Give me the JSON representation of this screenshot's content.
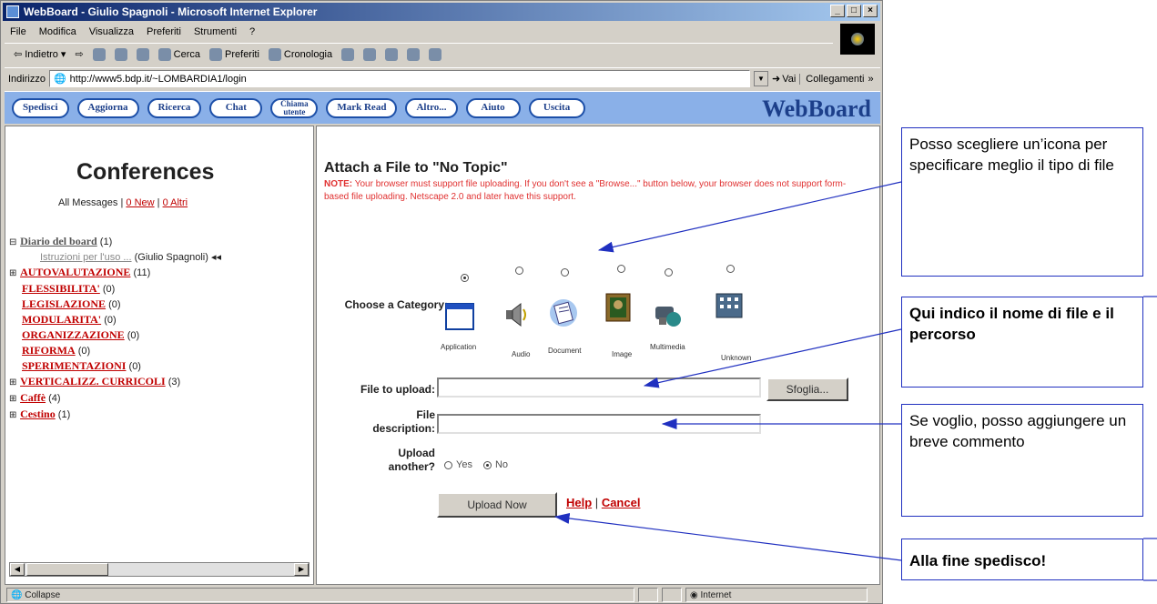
{
  "window": {
    "title": "WebBoard - Giulio Spagnoli - Microsoft Internet Explorer",
    "controls": [
      "_",
      "□",
      "×"
    ]
  },
  "menu": [
    "File",
    "Modifica",
    "Visualizza",
    "Preferiti",
    "Strumenti",
    "?"
  ],
  "toolbar": [
    "Indietro",
    "Cerca",
    "Preferiti",
    "Cronologia"
  ],
  "address": {
    "label": "Indirizzo",
    "url": "http://www5.bdp.it/~LOMBARDIA1/login",
    "go": "Vai",
    "links": "Collegamenti"
  },
  "webboard_nav": {
    "buttons": [
      "Spedisci",
      "Aggiorna",
      "Ricerca",
      "Chat",
      "Chiama utente",
      "Mark Read",
      "Altro...",
      "Aiuto",
      "Uscita"
    ],
    "logo": "WebBoard"
  },
  "conferences": {
    "title": "Conferences",
    "all_messages": "All Messages |",
    "new_link": "0 New",
    "altri_link": "0 Altri",
    "items": [
      {
        "name": "Diario del board",
        "count": "(1)",
        "marker": "⊟"
      },
      {
        "name": "Istruzioni per l'uso ...",
        "count": "(Giulio Spagnoli) ◂◂"
      },
      {
        "name": "AUTOVALUTAZIONE",
        "count": "(11)",
        "marker": "⊞"
      },
      {
        "name": "FLESSIBILITA'",
        "count": "(0)"
      },
      {
        "name": "LEGISLAZIONE",
        "count": "(0)"
      },
      {
        "name": "MODULARITA'",
        "count": "(0)"
      },
      {
        "name": "ORGANIZZAZIONE",
        "count": "(0)"
      },
      {
        "name": "RIFORMA",
        "count": "(0)"
      },
      {
        "name": "SPERIMENTAZIONI",
        "count": "(0)"
      },
      {
        "name": "VERTICALIZZ. CURRICOLI",
        "count": "(3)",
        "marker": "⊞"
      },
      {
        "name": "Caffè",
        "count": "(4)",
        "marker": "⊞"
      },
      {
        "name": "Cestino",
        "count": "(1)",
        "marker": "⊞"
      }
    ]
  },
  "attach": {
    "title": "Attach a File to \"No Topic\"",
    "note_label": "NOTE:",
    "note_text": "Your browser must support file uploading. If you don't see a \"Browse...\" button below, your browser does not support form-based file uploading. Netscape 2.0 and later have this support.",
    "category_label": "Choose a Category:",
    "categories": [
      "Application",
      "Audio",
      "Document",
      "Image",
      "Multimedia",
      "Unknown"
    ],
    "selected_category": "Application",
    "file_label": "File to upload:",
    "browse_button": "Sfoglia...",
    "desc_label": "File description:",
    "another_label": "Upload another?",
    "yes": "Yes",
    "no": "No",
    "another_selected": "No",
    "upload_button": "Upload Now",
    "help_link": "Help",
    "separator": "|",
    "cancel_link": "Cancel"
  },
  "statusbar": {
    "left": "Collapse",
    "zone": "Internet"
  },
  "callouts": {
    "icon": "Posso scegliere un’icona per specificare meglio il tipo di file",
    "file": "Qui indico il nome di file e il percorso",
    "comment": "Se voglio, posso aggiungere un breve commento",
    "send": "Alla fine spedisco!"
  },
  "colors": {
    "callout_border": "#2030c0",
    "link_red": "#c00000",
    "nav_blue": "#8ab0e8"
  }
}
